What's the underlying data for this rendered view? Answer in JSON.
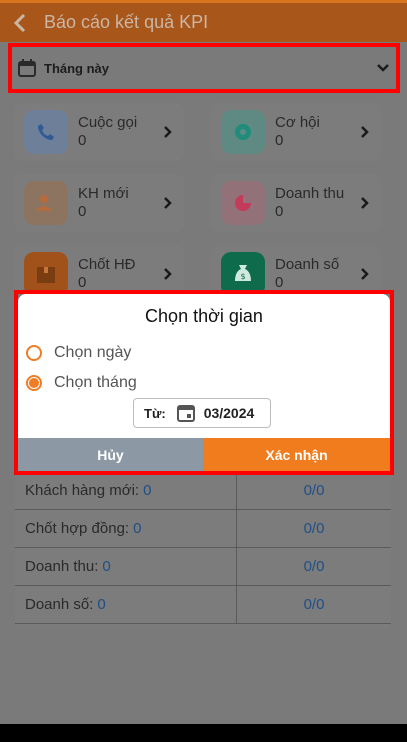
{
  "header": {
    "title": "Báo cáo kết quả KPI"
  },
  "period": {
    "label": "Tháng này"
  },
  "cards": [
    {
      "label": "Cuộc gọi",
      "value": "0",
      "icon": "phone-icon",
      "color": "#4a6fa3"
    },
    {
      "label": "Cơ hội",
      "value": "0",
      "icon": "opportunity-icon",
      "color": "#1f8c7c"
    },
    {
      "label": "KH mới",
      "value": "0",
      "icon": "new-customer-icon",
      "color": "#b56b3c"
    },
    {
      "label": "Doanh thu",
      "value": "0",
      "icon": "pie-chart-icon",
      "color": "#c33a5a"
    },
    {
      "label": "Chốt HĐ",
      "value": "0",
      "icon": "box-icon",
      "color": "#a8581c"
    },
    {
      "label": "Doanh số",
      "value": "0",
      "icon": "money-bag-icon",
      "color": "#13825d"
    }
  ],
  "table": {
    "rows": [
      {
        "label": "Khách hàng mới:",
        "num": "0",
        "ratio": "0/0"
      },
      {
        "label": "Chốt hợp đồng:",
        "num": "0",
        "ratio": "0/0"
      },
      {
        "label": "Doanh thu:",
        "num": "0",
        "ratio": "0/0"
      },
      {
        "label": "Doanh số:",
        "num": "0",
        "ratio": "0/0"
      }
    ]
  },
  "dialog": {
    "title": "Chọn thời gian",
    "option_day": "Chọn ngày",
    "option_month": "Chọn tháng",
    "selected": "month",
    "from_label": "Từ:",
    "date_value": "03/2024",
    "cancel_label": "Hủy",
    "confirm_label": "Xác nhận"
  },
  "colors": {
    "accent": "#f07c1d",
    "highlight": "#ff0000",
    "link": "#1f4f86"
  }
}
